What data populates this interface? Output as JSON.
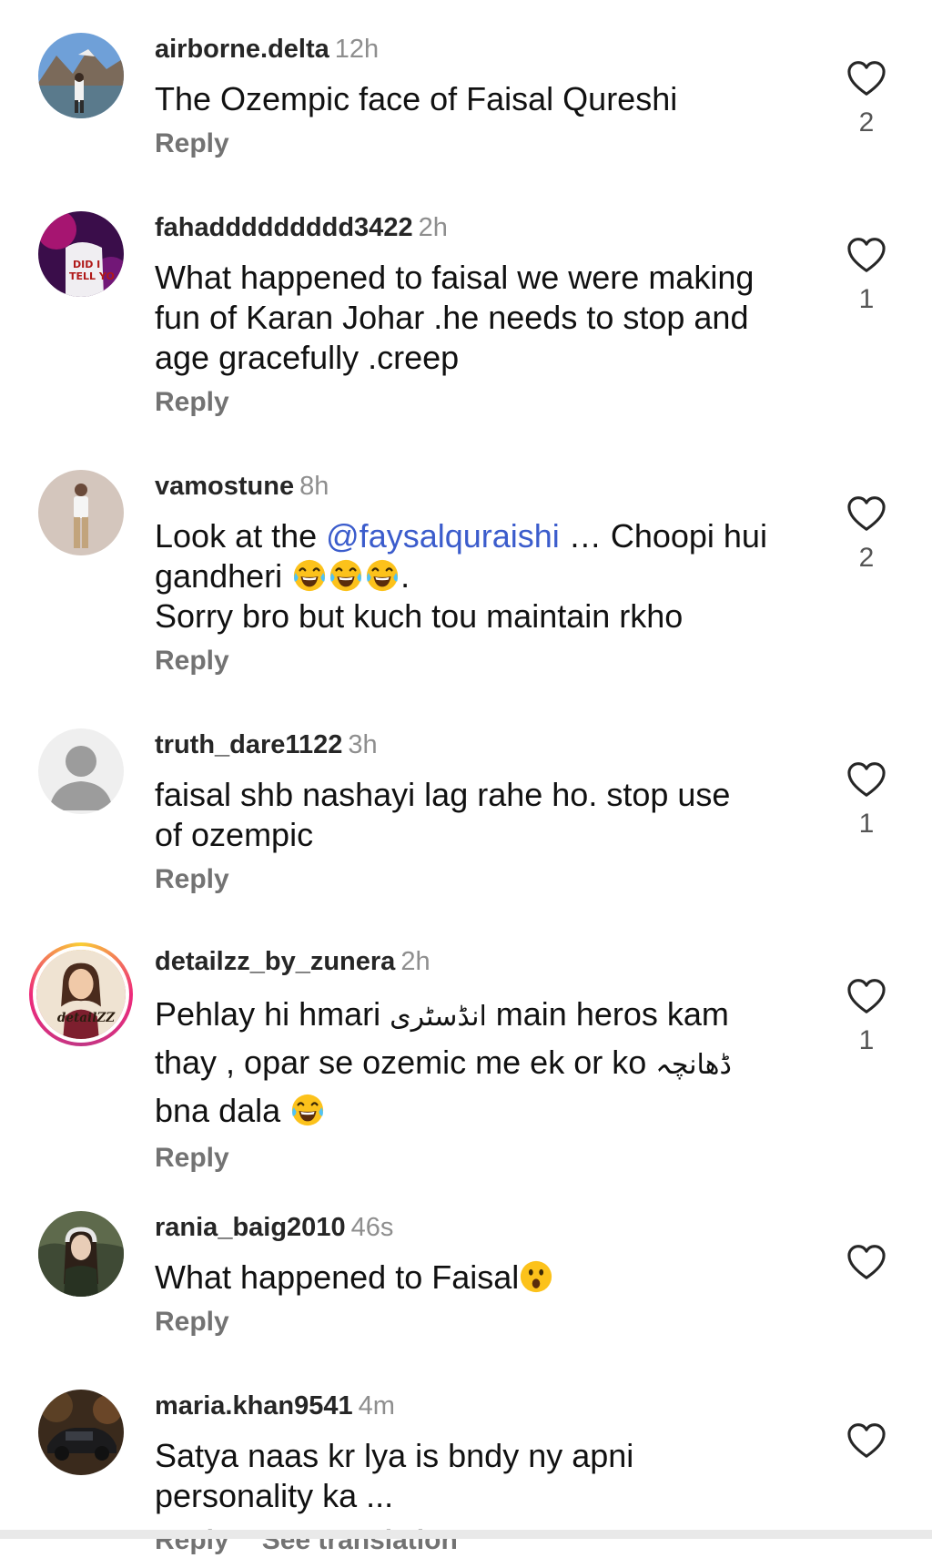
{
  "comments": [
    {
      "username": "airborne.delta",
      "time": "12h",
      "text": "The Ozempic face of Faisal Qureshi",
      "reply_label": "Reply",
      "likes": "2"
    },
    {
      "username": "fahaddddddddd3422",
      "time": "2h",
      "text_lines": [
        "What happened to faisal we were making",
        "fun of Karan Johar .he needs to stop and",
        "age gracefully .creep"
      ],
      "reply_label": "Reply",
      "likes": "1"
    },
    {
      "username": "vamostune",
      "time": "8h",
      "text_before_mention": "Look at the ",
      "mention": "@faysalquraishi",
      "text_after_mention": " … Choopi hui",
      "line2_text": "gandheri ",
      "line2_end": ".",
      "line3_text": "Sorry bro but kuch tou maintain rkho",
      "emoji": "laughing-tears-emoji",
      "reply_label": "Reply",
      "likes": "2"
    },
    {
      "username": "truth_dare1122",
      "time": "3h",
      "text_lines": [
        "faisal shb nashayi lag rahe ho. stop use",
        "of ozempic"
      ],
      "reply_label": "Reply",
      "likes": "1"
    },
    {
      "username": "detailzz_by_zunera",
      "time": "2h",
      "line1_a": "Pehlay hi hmari ",
      "line1_urdu": "انڈسٹری",
      "line1_b": " main heros kam",
      "line2_a": "thay , opar se ozemic me ek or ko ",
      "line2_urdu": "ڈھانچہ",
      "line3_a": "bna dala ",
      "emoji": "laughing-tears-emoji",
      "reply_label": "Reply",
      "likes": "1"
    },
    {
      "username": "rania_baig2010",
      "time": "46s",
      "text": "What happened to Faisal",
      "emoji": "astonished-emoji",
      "reply_label": "Reply",
      "likes": ""
    },
    {
      "username": "maria.khan9541",
      "time": "4m",
      "text_lines": [
        "Satya naas kr lya is bndy ny apni",
        "personality ka ..."
      ],
      "reply_label": "Reply",
      "see_translation_label": "See translation",
      "likes": ""
    }
  ],
  "colors": {
    "username": "#262626",
    "time": "#8e8e8e",
    "reply": "#737373",
    "mention": "#3b5ccc"
  },
  "icons": {
    "like": "heart-outline-icon"
  }
}
